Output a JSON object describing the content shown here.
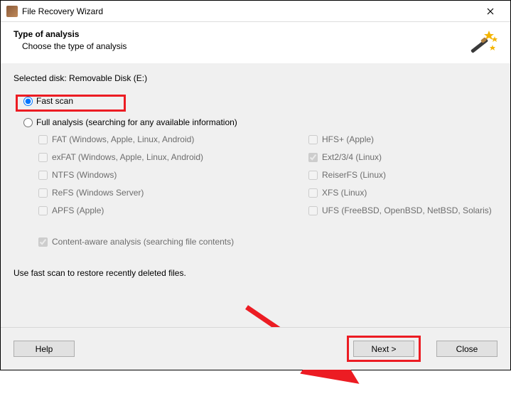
{
  "window": {
    "title": "File Recovery Wizard"
  },
  "header": {
    "title": "Type of analysis",
    "subtitle": "Choose the type of analysis"
  },
  "selected_disk_label": "Selected disk: Removable Disk (E:)",
  "radio": {
    "fast": "Fast scan",
    "full": "Full analysis (searching for any available information)"
  },
  "fs": {
    "fat": "FAT (Windows, Apple, Linux, Android)",
    "exfat": "exFAT (Windows, Apple, Linux, Android)",
    "ntfs": "NTFS (Windows)",
    "refs": "ReFS (Windows Server)",
    "apfs": "APFS (Apple)",
    "hfs": "HFS+ (Apple)",
    "ext": "Ext2/3/4 (Linux)",
    "reiser": "ReiserFS (Linux)",
    "xfs": "XFS (Linux)",
    "ufs": "UFS (FreeBSD, OpenBSD, NetBSD, Solaris)"
  },
  "content_aware": "Content-aware analysis (searching file contents)",
  "hint": "Use fast scan to restore recently deleted files.",
  "buttons": {
    "help": "Help",
    "next": "Next >",
    "close": "Close"
  }
}
